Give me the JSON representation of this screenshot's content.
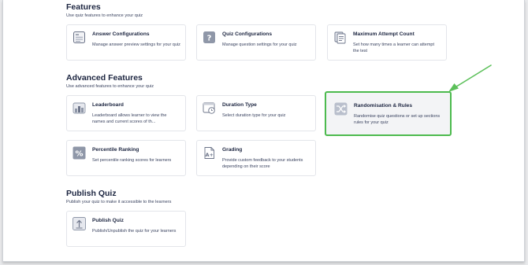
{
  "sections": {
    "features": {
      "title": "Features",
      "subtitle": "Use quiz features to enhance your quiz",
      "cards": [
        {
          "title": "Answer Configurations",
          "desc": "Manage answer preview settings for your quiz"
        },
        {
          "title": "Quiz Configurations",
          "desc": "Manage question settings for your quiz"
        },
        {
          "title": "Maximum Attempt Count",
          "desc": "Set how many times a learner can attempt the test"
        }
      ]
    },
    "advanced": {
      "title": "Advanced Features",
      "subtitle": "Use advanced features to enhance your quiz",
      "cards": [
        {
          "title": "Leaderboard",
          "desc": "Leaderboard allows learner to view the names and current scores of th..."
        },
        {
          "title": "Duration Type",
          "desc": "Select duration type for your quiz"
        },
        {
          "title": "Randomisation & Rules",
          "desc": "Randomise quiz questions or set up sections rules for your quiz"
        },
        {
          "title": "Percentile Ranking",
          "desc": "Set percentile ranking scores for learners"
        },
        {
          "title": "Grading",
          "desc": "Provide custom feedback to your students depending on their score"
        }
      ]
    },
    "publish": {
      "title": "Publish Quiz",
      "subtitle": "Publish your quiz to make it accessible to the learners",
      "cards": [
        {
          "title": "Publish Quiz",
          "desc": "Publish/Unpublish the quiz for your learners"
        }
      ]
    }
  },
  "icons": {
    "answer": "answer-config-icon",
    "quiz": "question-mark-icon",
    "attempt": "document-stack-icon",
    "leaderboard": "leaderboard-icon",
    "duration": "timer-window-icon",
    "random": "shuffle-icon",
    "percentile": "percent-icon",
    "grading": "grade-letter-icon",
    "publish": "upload-arrow-icon"
  },
  "colors": {
    "highlight_border": "#4cba4e",
    "annotation_arrow": "#5cc05a",
    "heading": "#1c2540"
  }
}
